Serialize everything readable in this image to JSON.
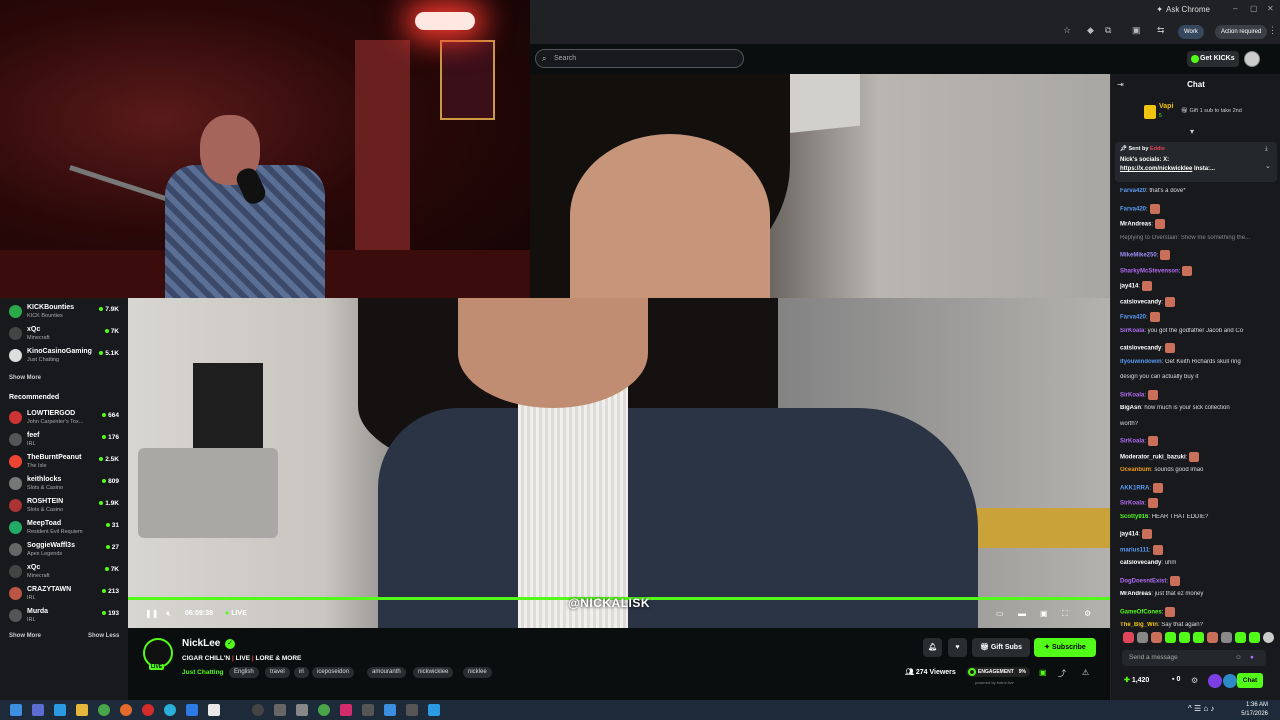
{
  "browser": {
    "ask_chrome": "Ask Chrome",
    "profile": "Work",
    "action_required": "Action required"
  },
  "header": {
    "search_placeholder": "Search",
    "get_kicks": "Get KICKs"
  },
  "sidebar": {
    "following": [
      {
        "name": "KICKBounties",
        "sub": "KICK Bounties",
        "viewers": "7.9K",
        "color": "#2aa84a"
      },
      {
        "name": "xQc",
        "sub": "Minecraft",
        "viewers": "7K",
        "color": "#444"
      },
      {
        "name": "KinoCasinoGaming",
        "sub": "Just Chatting",
        "viewers": "5.1K",
        "color": "#ddd"
      }
    ],
    "show_more_1": "Show More",
    "recommended_title": "Recommended",
    "recommended": [
      {
        "name": "LOWTIERGOD",
        "sub": "John Carpenter's Tox...",
        "viewers": "664",
        "color": "#c33"
      },
      {
        "name": "feef",
        "sub": "IRL",
        "viewers": "176",
        "color": "#555"
      },
      {
        "name": "TheBurntPeanut",
        "sub": "The Isle",
        "viewers": "2.5K",
        "color": "#e43"
      },
      {
        "name": "keithlocks",
        "sub": "Slots & Casino",
        "viewers": "809",
        "color": "#777"
      },
      {
        "name": "ROSHTEIN",
        "sub": "Slots & Casino",
        "viewers": "1.9K",
        "color": "#a33"
      },
      {
        "name": "MeepToad",
        "sub": "Resident Evil Requiem",
        "viewers": "31",
        "color": "#2a6"
      },
      {
        "name": "SoggieWaffl3s",
        "sub": "Apex Legends",
        "viewers": "27",
        "color": "#666"
      },
      {
        "name": "xQc",
        "sub": "Minecraft",
        "viewers": "7K",
        "color": "#444"
      },
      {
        "name": "CRAZYTAWN",
        "sub": "IRL",
        "viewers": "213",
        "color": "#b54"
      },
      {
        "name": "Murda",
        "sub": "IRL",
        "viewers": "193",
        "color": "#555"
      }
    ],
    "show_more_2": "Show More",
    "show_less": "Show Less"
  },
  "player": {
    "watermark": "@NICKALISK",
    "time": "06:09:38",
    "live": "LIVE",
    "progress": 1.0
  },
  "channel": {
    "name": "NickLee",
    "live_badge": "LIVE",
    "title_parts": [
      "CIGAR CHILL'N",
      "|",
      "LIVE",
      "|",
      "LORE & MORE"
    ],
    "category": "Just Chatting",
    "tags": [
      "English",
      "travel",
      "irl",
      "iceposeidon",
      "amouranth",
      "nickwicklee",
      "nicklee"
    ],
    "gift_subs": "Gift Subs",
    "subscribe": "Subscribe",
    "viewers": "274 Viewers",
    "engagement_label": "ENGAGEMENT",
    "engagement_pct": "9%",
    "powered_by": "powered by botrix.live"
  },
  "chat": {
    "title": "Chat",
    "gift": {
      "user": "Vapi",
      "count": "5",
      "message": "Gift 1 sub to take 2nd"
    },
    "pinned": {
      "sent_by": "Sent by",
      "sender": "Eddie",
      "text_prefix": "Nick's socials: X:",
      "link": "https://x.com/nickwicklee",
      "text_suffix": "Insta:..."
    },
    "messages": [
      {
        "user": "Farva420",
        "color": "#5b9cf5",
        "text": ": that's a dove*",
        "emote": false
      },
      {
        "user": "Farva420",
        "color": "#5b9cf5",
        "text": ":",
        "emote": true
      },
      {
        "user": "MrAndreas",
        "color": "#ffffff",
        "text": ":",
        "emote": true
      },
      {
        "user": "",
        "color": "#888",
        "text": "Replying to Overstain: Show me something the...",
        "emote": false
      },
      {
        "user": "MikeMike250",
        "color": "#9b8cf5",
        "text": ":",
        "emote": true
      },
      {
        "user": "SharkyMcStevenson",
        "color": "#b26cf5",
        "text": ":",
        "emote": true
      },
      {
        "user": "jay414",
        "color": "#ffffff",
        "text": ":",
        "emote": true
      },
      {
        "user": "catslovecandy",
        "color": "#ffffff",
        "text": ":",
        "emote": true
      },
      {
        "user": "Farva420",
        "color": "#5b9cf5",
        "text": ":",
        "emote": true
      },
      {
        "user": "SirKoala",
        "color": "#b26cf5",
        "text": ": you got the godfather Jacob and Co",
        "emote": false
      },
      {
        "user": "catslovecandy",
        "color": "#ffffff",
        "text": ":",
        "emote": true
      },
      {
        "user": "ifyouwindowin",
        "color": "#5b9cf5",
        "text": ": Get Keith Richards skull ring",
        "emote": false
      },
      {
        "user": "",
        "color": "#ddd",
        "text": "design you can actually buy it",
        "emote": false
      },
      {
        "user": "SirKoala",
        "color": "#b26cf5",
        "text": ":",
        "emote": true
      },
      {
        "user": "BigAsn",
        "color": "#ffffff",
        "text": ": how much is your sick collection",
        "emote": false
      },
      {
        "user": "",
        "color": "#ddd",
        "text": "worth?",
        "emote": false
      },
      {
        "user": "SirKoala",
        "color": "#b26cf5",
        "text": ":",
        "emote": true
      },
      {
        "user": "Moderator_ruki_bazuki",
        "color": "#ffffff",
        "text": ":",
        "emote": true
      },
      {
        "user": "Oceanbum",
        "color": "#f39c12",
        "text": ": sounds good lmao",
        "emote": false
      },
      {
        "user": "AKK1RRA",
        "color": "#5b9cf5",
        "text": ":",
        "emote": true
      },
      {
        "user": "SirKoala",
        "color": "#b26cf5",
        "text": ":",
        "emote": true
      },
      {
        "user": "Scotty916",
        "color": "#53fc18",
        "text": ": HEAR THAT EDDIE?",
        "emote": false
      },
      {
        "user": "jay414",
        "color": "#ffffff",
        "text": ":",
        "emote": true
      },
      {
        "user": "marius111",
        "color": "#5b9cf5",
        "text": ":",
        "emote": true
      },
      {
        "user": "catslovecandy",
        "color": "#ffffff",
        "text": ": uhm",
        "emote": false
      },
      {
        "user": "DogDoesntExist",
        "color": "#b26cf5",
        "text": ":",
        "emote": true
      },
      {
        "user": "MrAndreas",
        "color": "#ffffff",
        "text": ": just that ez money",
        "emote": false
      },
      {
        "user": "GameOfCones",
        "color": "#53fc18",
        "text": ":",
        "emote": true
      },
      {
        "user": "The_Big_Win",
        "color": "#f1c40f",
        "text": ": Say that again?",
        "emote": false
      }
    ],
    "input_placeholder": "Send a message",
    "kicks": "1,420",
    "zero": "0",
    "send": "Chat"
  },
  "taskbar": {
    "time": "1:36 AM",
    "date": "5/17/2026"
  }
}
